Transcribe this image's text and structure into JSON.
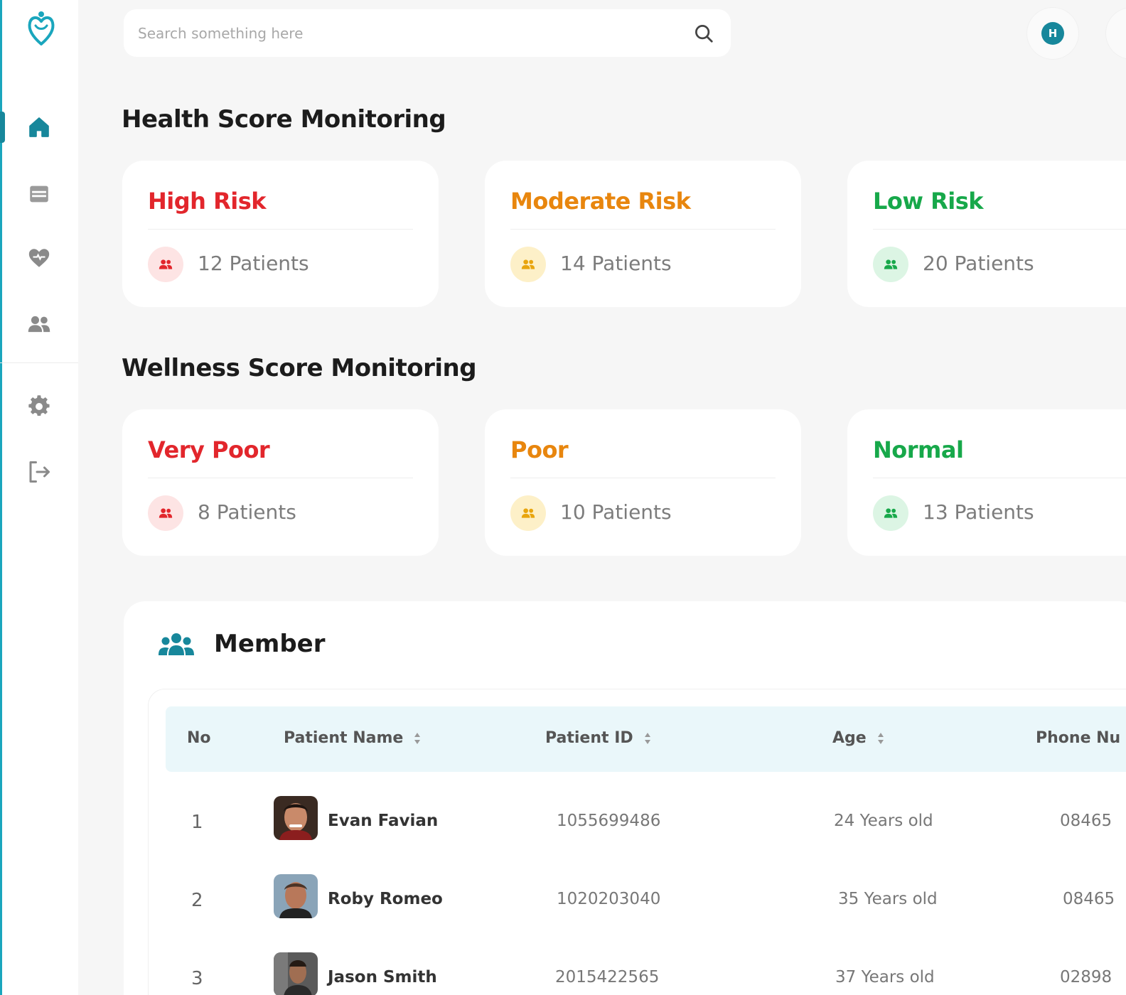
{
  "search": {
    "placeholder": "Search something here"
  },
  "user": {
    "initial": "H"
  },
  "health": {
    "title": "Health Score Monitoring",
    "cards": [
      {
        "label": "High Risk",
        "count": "12 Patients"
      },
      {
        "label": "Moderate Risk",
        "count": "14 Patients"
      },
      {
        "label": "Low Risk",
        "count": "20 Patients"
      }
    ]
  },
  "wellness": {
    "title": "Wellness Score Monitoring",
    "cards": [
      {
        "label": "Very Poor",
        "count": "8 Patients"
      },
      {
        "label": "Poor",
        "count": "10 Patients"
      },
      {
        "label": "Normal",
        "count": "13 Patients"
      }
    ]
  },
  "member": {
    "title": "Member",
    "columns": [
      "No",
      "Patient Name",
      "Patient ID",
      "Age",
      "Phone Nu"
    ],
    "rows": [
      {
        "no": "1",
        "name": "Evan Favian",
        "id": "1055699486",
        "age": "24 Years old",
        "phone": "08465"
      },
      {
        "no": "2",
        "name": "Roby Romeo",
        "id": "1020203040",
        "age": "35 Years old",
        "phone": "08465"
      },
      {
        "no": "3",
        "name": "Jason Smith",
        "id": "2015422565",
        "age": "37 Years old",
        "phone": "02898"
      }
    ]
  },
  "colors": {
    "accent": "#17879b",
    "red": "#e2262c",
    "orange": "#e8860e",
    "green": "#17a84a",
    "red_bg": "#fde4e4",
    "orange_bg": "#fdf0c8",
    "green_bg": "#dcf5e4"
  },
  "icons": {
    "logo": "heart-hands-logo",
    "nav": [
      "home-icon",
      "calendar-icon",
      "heart-icon",
      "users-icon",
      "gear-icon",
      "logout-icon"
    ]
  }
}
